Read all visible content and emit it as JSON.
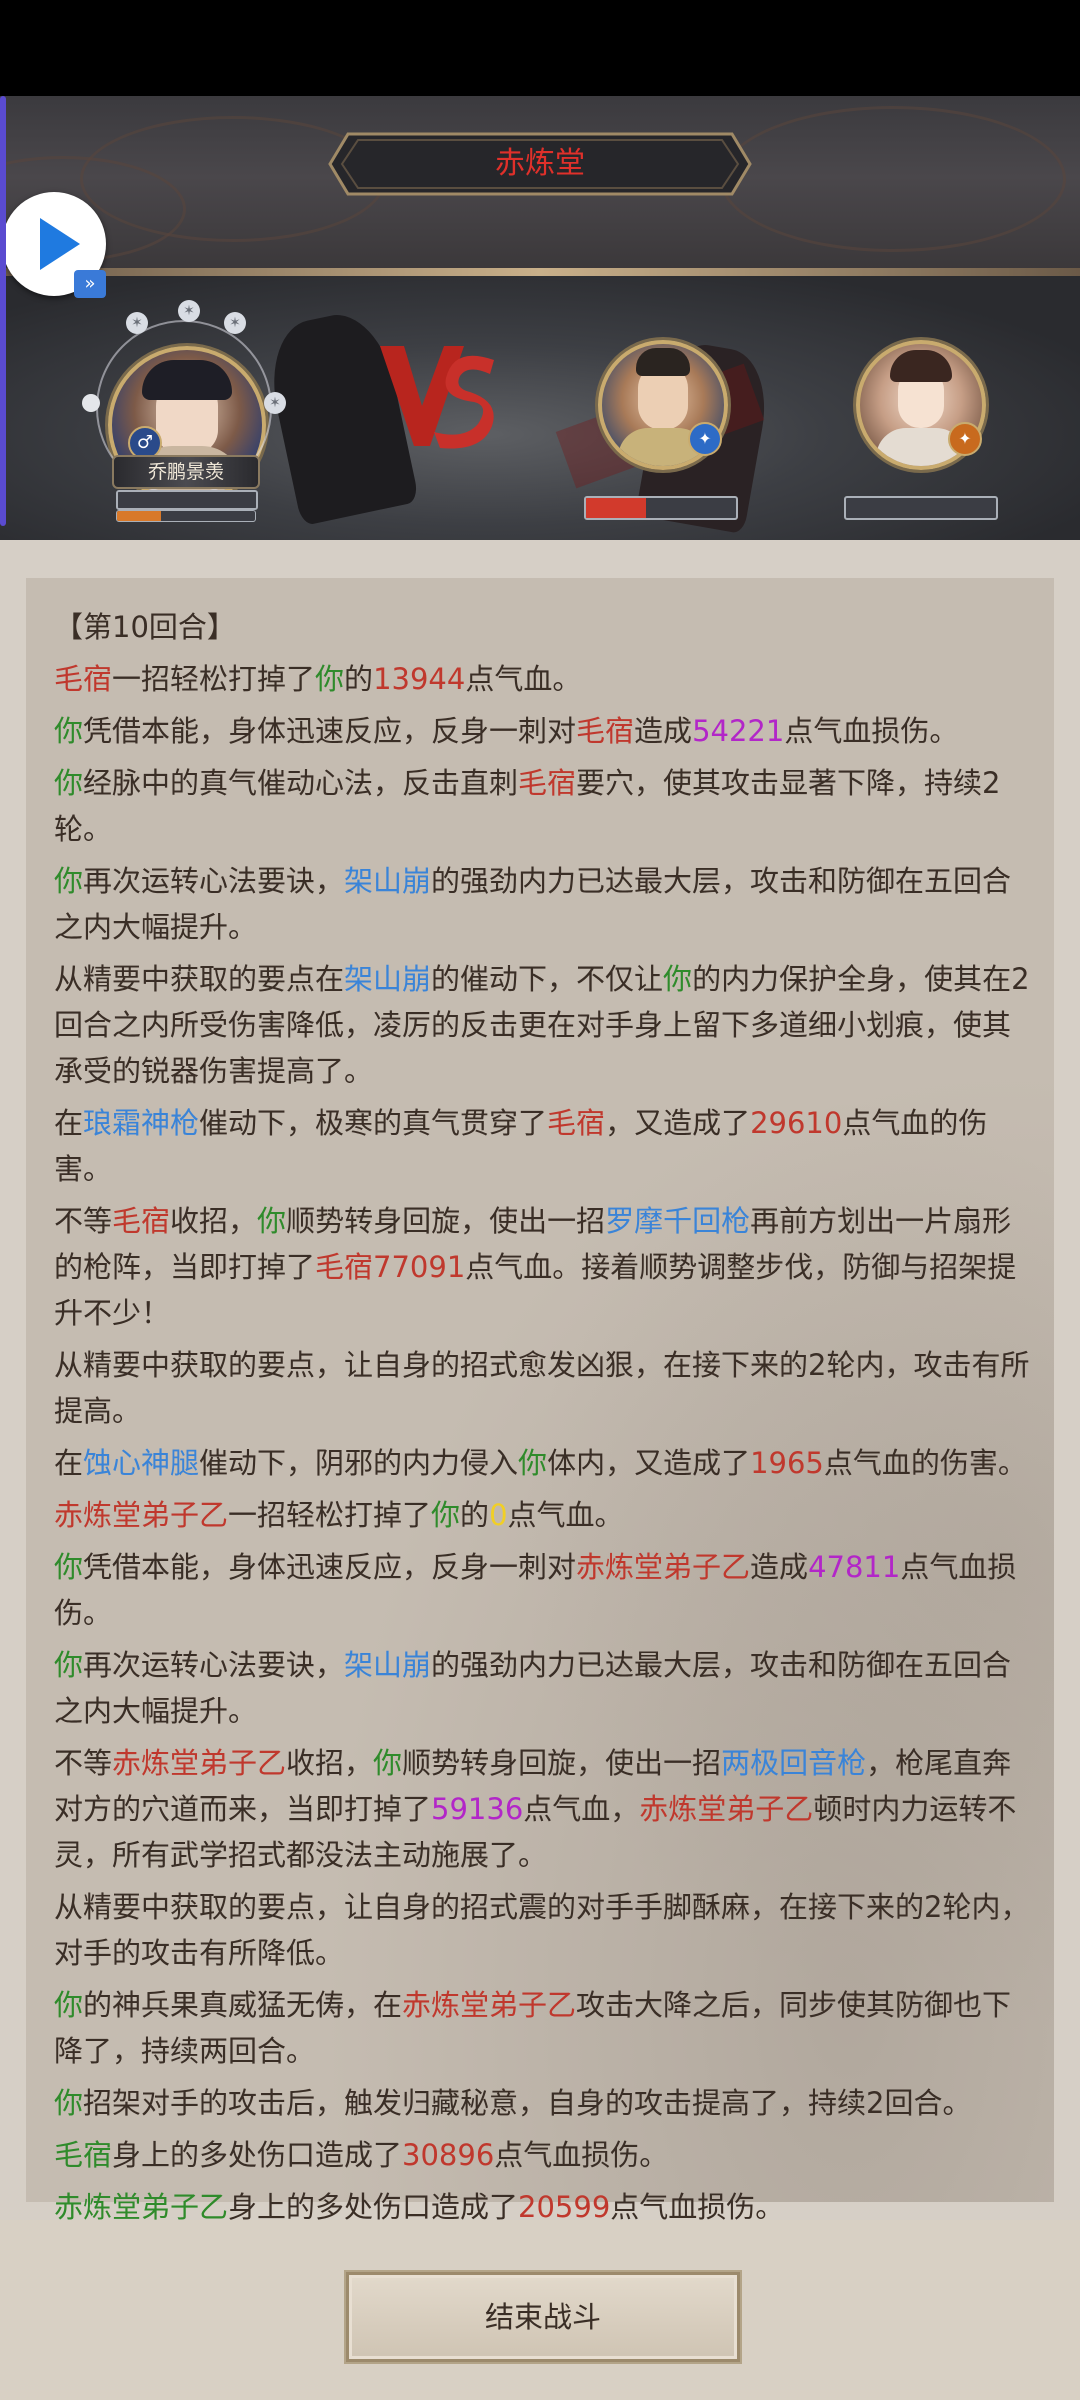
{
  "header": {
    "title": "赤炼堂"
  },
  "player": {
    "name": "乔鹏景羡",
    "hp_fraction": 1.0,
    "mp_fraction": 0.32
  },
  "enemies": [
    {
      "hp_fraction": 0.4
    },
    {
      "hp_fraction": 0.0
    }
  ],
  "log": [
    [
      {
        "t": "【第10回合】",
        "c": ""
      }
    ],
    [
      {
        "t": "毛宿",
        "c": "r"
      },
      {
        "t": "一招轻松打掉了",
        "c": ""
      },
      {
        "t": "你",
        "c": "g"
      },
      {
        "t": "的",
        "c": ""
      },
      {
        "t": "13944",
        "c": "r"
      },
      {
        "t": "点气血。",
        "c": ""
      }
    ],
    [
      {
        "t": "你",
        "c": "g"
      },
      {
        "t": "凭借本能，身体迅速反应，反身一刺对",
        "c": ""
      },
      {
        "t": "毛宿",
        "c": "r"
      },
      {
        "t": "造成",
        "c": ""
      },
      {
        "t": "54221",
        "c": "p"
      },
      {
        "t": "点气血损伤。",
        "c": ""
      }
    ],
    [
      {
        "t": "你",
        "c": "g"
      },
      {
        "t": "经脉中的真气催动心法，反击直刺",
        "c": ""
      },
      {
        "t": "毛宿",
        "c": "r"
      },
      {
        "t": "要穴，使其攻击显著下降，持续2轮。",
        "c": ""
      }
    ],
    [
      {
        "t": "你",
        "c": "g"
      },
      {
        "t": "再次运转心法要诀，",
        "c": ""
      },
      {
        "t": "架山崩",
        "c": "b"
      },
      {
        "t": "的强劲内力已达最大层，攻击和防御在五回合之内大幅提升。",
        "c": ""
      }
    ],
    [
      {
        "t": "从精要中获取的要点在",
        "c": ""
      },
      {
        "t": "架山崩",
        "c": "b"
      },
      {
        "t": "的催动下，不仅让",
        "c": ""
      },
      {
        "t": "你",
        "c": "g"
      },
      {
        "t": "的内力保护全身，使其在2回合之内所受伤害降低，凌厉的反击更在对手身上留下多道细小划痕，使其承受的锐器伤害提高了。",
        "c": ""
      }
    ],
    [
      {
        "t": "在",
        "c": ""
      },
      {
        "t": "琅霜神枪",
        "c": "b"
      },
      {
        "t": "催动下，极寒的真气贯穿了",
        "c": ""
      },
      {
        "t": "毛宿",
        "c": "r"
      },
      {
        "t": "，又造成了",
        "c": ""
      },
      {
        "t": "29610",
        "c": "r"
      },
      {
        "t": "点气血的伤害。",
        "c": ""
      }
    ],
    [
      {
        "t": "不等",
        "c": ""
      },
      {
        "t": "毛宿",
        "c": "r"
      },
      {
        "t": "收招，",
        "c": ""
      },
      {
        "t": "你",
        "c": "g"
      },
      {
        "t": "顺势转身回旋，使出一招",
        "c": ""
      },
      {
        "t": "罗摩千回枪",
        "c": "b"
      },
      {
        "t": "再前方划出一片扇形的枪阵，当即打掉了",
        "c": ""
      },
      {
        "t": "毛宿",
        "c": "r"
      },
      {
        "t": "77091",
        "c": "r"
      },
      {
        "t": "点气血。接着顺势调整步伐，防御与招架提升不少！",
        "c": ""
      }
    ],
    [
      {
        "t": "从精要中获取的要点，让自身的招式愈发凶狠，在接下来的2轮内，攻击有所提高。",
        "c": ""
      }
    ],
    [
      {
        "t": "在",
        "c": ""
      },
      {
        "t": "蚀心神腿",
        "c": "b"
      },
      {
        "t": "催动下，阴邪的内力侵入",
        "c": ""
      },
      {
        "t": "你",
        "c": "g"
      },
      {
        "t": "体内，又造成了",
        "c": ""
      },
      {
        "t": "1965",
        "c": "r"
      },
      {
        "t": "点气血的伤害。",
        "c": ""
      }
    ],
    [
      {
        "t": "赤炼堂弟子乙",
        "c": "r"
      },
      {
        "t": "一招轻松打掉了",
        "c": ""
      },
      {
        "t": "你",
        "c": "g"
      },
      {
        "t": "的",
        "c": ""
      },
      {
        "t": "0",
        "c": "y"
      },
      {
        "t": "点气血。",
        "c": ""
      }
    ],
    [
      {
        "t": "你",
        "c": "g"
      },
      {
        "t": "凭借本能，身体迅速反应，反身一刺对",
        "c": ""
      },
      {
        "t": "赤炼堂弟子乙",
        "c": "r"
      },
      {
        "t": "造成",
        "c": ""
      },
      {
        "t": "47811",
        "c": "p"
      },
      {
        "t": "点气血损伤。",
        "c": ""
      }
    ],
    [
      {
        "t": "你",
        "c": "g"
      },
      {
        "t": "再次运转心法要诀，",
        "c": ""
      },
      {
        "t": "架山崩",
        "c": "b"
      },
      {
        "t": "的强劲内力已达最大层，攻击和防御在五回合之内大幅提升。",
        "c": ""
      }
    ],
    [
      {
        "t": "不等",
        "c": ""
      },
      {
        "t": "赤炼堂弟子乙",
        "c": "r"
      },
      {
        "t": "收招，",
        "c": ""
      },
      {
        "t": "你",
        "c": "g"
      },
      {
        "t": "顺势转身回旋，使出一招",
        "c": ""
      },
      {
        "t": "两极回音枪",
        "c": "b"
      },
      {
        "t": "，枪尾直奔对方的穴道而来，当即打掉了",
        "c": ""
      },
      {
        "t": "59136",
        "c": "p"
      },
      {
        "t": "点气血，",
        "c": ""
      },
      {
        "t": "赤炼堂弟子乙",
        "c": "r"
      },
      {
        "t": "顿时内力运转不灵，所有武学招式都没法主动施展了。",
        "c": ""
      }
    ],
    [
      {
        "t": "从精要中获取的要点，让自身的招式震的对手手脚酥麻，在接下来的2轮内，对手的攻击有所降低。",
        "c": ""
      }
    ],
    [
      {
        "t": "你",
        "c": "g"
      },
      {
        "t": "的神兵果真威猛无俦，在",
        "c": ""
      },
      {
        "t": "赤炼堂弟子乙",
        "c": "r"
      },
      {
        "t": "攻击大降之后，同步使其防御也下降了，持续两回合。",
        "c": ""
      }
    ],
    [
      {
        "t": "你",
        "c": "g"
      },
      {
        "t": "招架对手的攻击后，触发归藏秘意，自身的攻击提高了，持续2回合。",
        "c": ""
      }
    ],
    [
      {
        "t": "毛宿",
        "c": "g"
      },
      {
        "t": "身上的多处伤口造成了",
        "c": ""
      },
      {
        "t": "30896",
        "c": "r"
      },
      {
        "t": "点气血损伤。",
        "c": ""
      }
    ],
    [
      {
        "t": "赤炼堂弟子乙",
        "c": "g"
      },
      {
        "t": "身上的多处伤口造成了",
        "c": ""
      },
      {
        "t": "20599",
        "c": "r"
      },
      {
        "t": "点气血损伤。",
        "c": ""
      }
    ]
  ],
  "footer": {
    "end_button": "结束战斗"
  }
}
